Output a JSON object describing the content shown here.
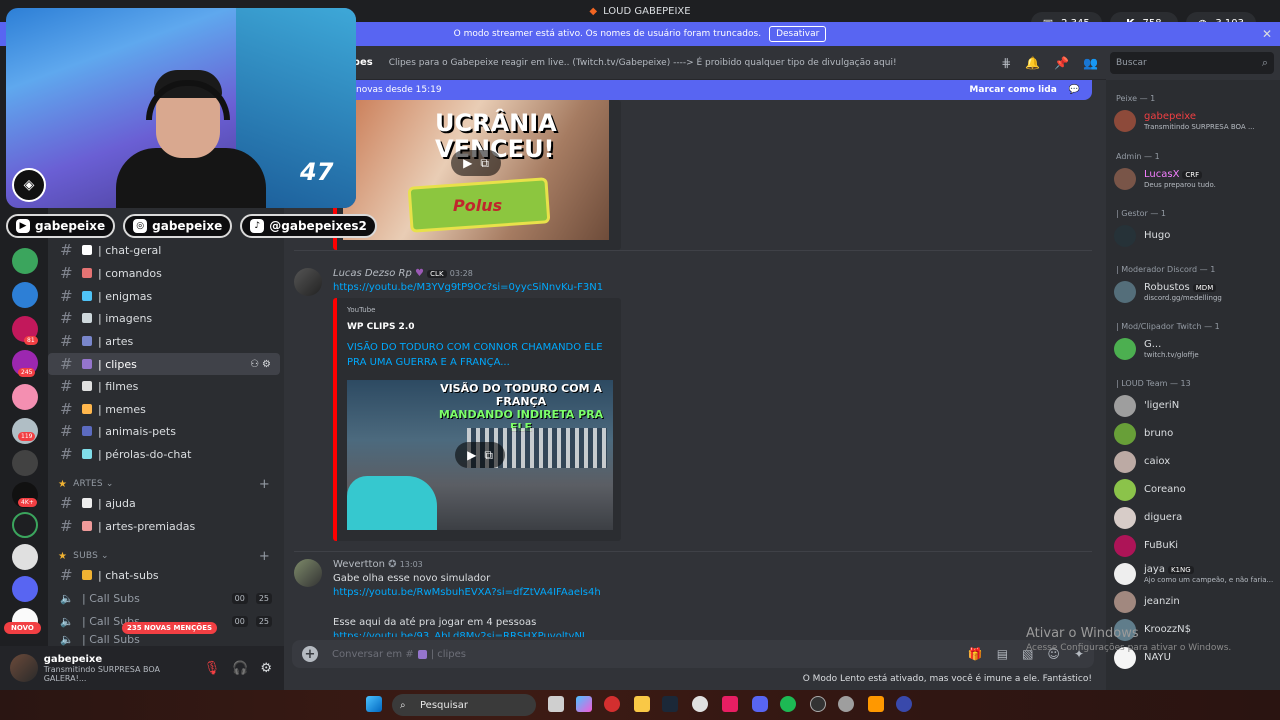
{
  "titlebar": {
    "title": "LOUD GABEPEIXE"
  },
  "counters": [
    {
      "icon": "twitch-icon",
      "value": "2.345"
    },
    {
      "icon": "kick-icon",
      "value": "758"
    },
    {
      "icon": "globe-icon",
      "value": "3.103"
    }
  ],
  "banner": {
    "text": "O modo streamer está ativo. Os nomes de usuário foram truncados.",
    "button": "Desativar"
  },
  "channel_header": {
    "name": "clipes",
    "topic": "Clipes para o Gabepeixe reagir em live.. (Twitch.tv/Gabepeixe) ----> É proibido qualquer tipo de divulgação aqui!"
  },
  "search": {
    "placeholder": "Buscar"
  },
  "new_messages": {
    "left": "novas desde 15:19",
    "right": "Marcar como lida"
  },
  "webcam": {
    "counter": "47"
  },
  "socials": [
    "gabepeixe",
    "gabepeixe",
    "@gabepeixes2"
  ],
  "channels": [
    {
      "name": "| chat-geral",
      "emoji_color": "#ffffff"
    },
    {
      "name": "| comandos",
      "emoji_color": "#e57373"
    },
    {
      "name": "| enigmas",
      "emoji_color": "#4fc3f7"
    },
    {
      "name": "| imagens",
      "emoji_color": "#cfd8dc"
    },
    {
      "name": "| artes",
      "emoji_color": "#7986cb"
    },
    {
      "name": "| clipes",
      "emoji_color": "#9575cd"
    },
    {
      "name": "| filmes",
      "emoji_color": "#e0e0e0"
    },
    {
      "name": "| memes",
      "emoji_color": "#ffb74d"
    },
    {
      "name": "| animais-pets",
      "emoji_color": "#5c6bc0"
    },
    {
      "name": "| pérolas-do-chat",
      "emoji_color": "#80deea"
    }
  ],
  "cat_artes": {
    "label": "ARTES",
    "channels": [
      "| ajuda",
      "| artes-premiadas"
    ]
  },
  "cat_subs": {
    "label": "SUBS",
    "channels": [
      "| chat-subs",
      "| Call Subs",
      "| Call Subs",
      "| Call Subs"
    ],
    "pill_a": "00",
    "pill_b": "25"
  },
  "mentions": "235 NOVAS MENÇÕES",
  "novo": "NOVO",
  "user": {
    "name": "gabepeixe",
    "status": "Transmitindo SURPRESA BOA GALERA!..."
  },
  "messages": [
    {
      "author": "Lucas Dezso Rp",
      "tag": "CLK",
      "time": "03:28",
      "link": "https://youtu.be/M3YVg9tP9Oc?si=0yycSiNnvKu-F3N1",
      "embed": {
        "provider": "YouTube",
        "title": "WP CLIPS 2.0",
        "description": "VISÃO DO TODURO COM CONNOR CHAMANDO ELE PRA UMA GUERRA E A FRANÇA...",
        "thumb_line1": "VISÃO DO TODURO COM A FRANÇA",
        "thumb_line2": "MANDANDO INDIRETA PRA ELE"
      }
    },
    {
      "author": "Wevertton",
      "time": "13:03",
      "text": "Gabe olha esse novo simulador",
      "link": "https://youtu.be/RwMsbuhEVXA?si=dfZtVA4IFAaels4h",
      "text2": "Esse aqui da até pra jogar em 4 pessoas",
      "link2": "https://youtu.be/93_AbLd8Mv2si=RRSHXPuvoltvNI"
    }
  ],
  "thumb1": {
    "title": "UCRÂNIA VENCEU!",
    "brand": "Polus"
  },
  "composer": {
    "placeholder": "Conversar em #",
    "channel": "| clipes"
  },
  "slowmode": "O Modo Lento está ativado, mas você é imune a ele. Fantástico!",
  "members": {
    "roles": [
      "Peixe — 1",
      "Admin — 1",
      "| Gestor — 1",
      "| Moderador Discord — 1",
      "| Mod/Clipador Twitch — 1",
      "| LOUD Team — 13"
    ],
    "list": [
      {
        "name": "gabepeixe",
        "status": "Transmitindo SURPRESA BOA ...",
        "color": "#f23f43"
      },
      {
        "name": "LucasX",
        "tag": "CRF",
        "status": "Deus preparou tudo.",
        "color": "#f47fff"
      },
      {
        "name": "Hugo",
        "status": "",
        "color": "#ffffff"
      },
      {
        "name": "Robustos",
        "tag": "MDM",
        "status": "discord.gg/medellingg",
        "color": "#ffffff"
      },
      {
        "name": "G...",
        "status": "twitch.tv/gloffje",
        "color": "#ffffff"
      },
      {
        "name": "'ligeriN",
        "status": "",
        "color": "#dbdee1"
      },
      {
        "name": "bruno",
        "status": "",
        "color": "#dbdee1"
      },
      {
        "name": "caiox",
        "status": "",
        "color": "#dbdee1"
      },
      {
        "name": "Coreano",
        "status": "",
        "color": "#dbdee1"
      },
      {
        "name": "diguera",
        "status": "",
        "color": "#dbdee1"
      },
      {
        "name": "FuBuKi",
        "status": "",
        "color": "#dbdee1"
      },
      {
        "name": "jaya",
        "tag": "K1NG",
        "status": "Ajo como um campeão, e não faria...",
        "color": "#dbdee1"
      },
      {
        "name": "jeanzin",
        "status": "",
        "color": "#dbdee1"
      },
      {
        "name": "KroozzN$",
        "status": "",
        "color": "#dbdee1"
      },
      {
        "name": "NAYU",
        "status": "",
        "color": "#dbdee1"
      }
    ]
  },
  "watermark": {
    "line1": "Ativar o Windows",
    "line2": "Acesse Configurações para ativar o Windows."
  },
  "taskbar": {
    "search": "Pesquisar"
  }
}
